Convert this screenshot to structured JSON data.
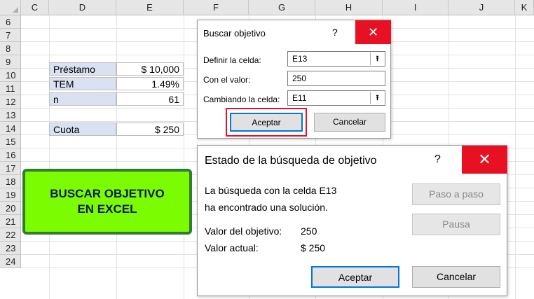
{
  "columns": [
    "C",
    "D",
    "E",
    "F",
    "G",
    "H",
    "I",
    "J",
    "K"
  ],
  "rows": [
    "6",
    "7",
    "8",
    "9",
    "10",
    "11",
    "12",
    "13",
    "14",
    "15",
    "16",
    "17",
    "18",
    "19",
    "20",
    "21",
    "22",
    "23",
    "24"
  ],
  "cells": {
    "prestamo_label": "Préstamo",
    "prestamo_value": "$ 10,000",
    "tem_label": "TEM",
    "tem_value": "1.49%",
    "n_label": "n",
    "n_value": "61",
    "cuota_label": "Cuota",
    "cuota_value": "$ 250"
  },
  "banner": {
    "line1": "BUSCAR OBJETIVO",
    "line2": "EN EXCEL"
  },
  "goal_seek_dialog": {
    "title": "Buscar objetivo",
    "help": "?",
    "close": "✕",
    "set_cell_label": "Definir la celda:",
    "set_cell_value": "E13",
    "to_value_label": "Con el valor:",
    "to_value_value": "250",
    "by_changing_label": "Cambiando la celda:",
    "by_changing_value": "E11",
    "ok_label": "Aceptar",
    "cancel_label": "Cancelar"
  },
  "status_dialog": {
    "title": "Estado de la búsqueda de objetivo",
    "help": "?",
    "close": "✕",
    "message_line1": "La búsqueda con la celda E13",
    "message_line2": "ha encontrado una solución.",
    "target_label": "Valor del objetivo:",
    "target_value": "250",
    "current_label": "Valor actual:",
    "current_value": "$ 250",
    "step_label": "Paso a paso",
    "pause_label": "Pausa",
    "ok_label": "Aceptar",
    "cancel_label": "Cancelar"
  },
  "colors": {
    "accent": "#0078d7",
    "close_red": "#e81123",
    "banner_green": "#7cfc00",
    "label_blue": "#d9e1f2"
  }
}
